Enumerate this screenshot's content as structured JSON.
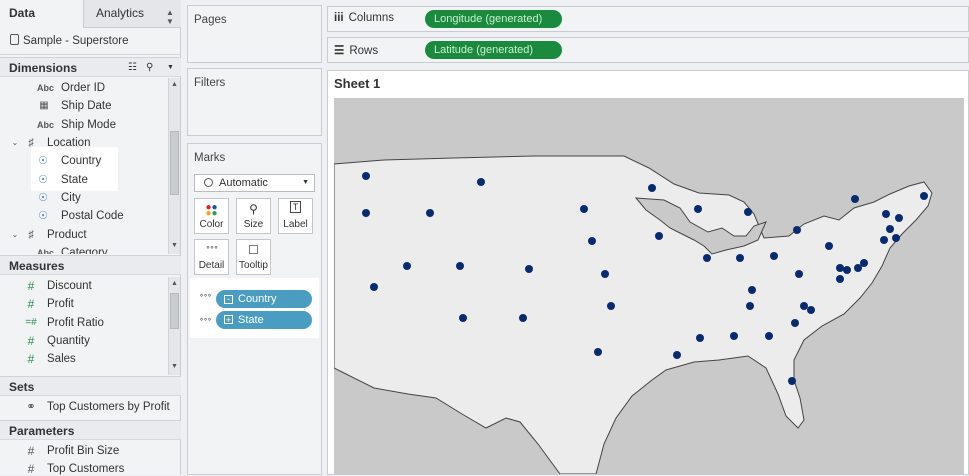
{
  "left_pane": {
    "tabs": {
      "data": "Data",
      "analytics": "Analytics"
    },
    "datasource": "Sample - Superstore",
    "dimensions": {
      "title": "Dimensions",
      "items": [
        {
          "icon": "Abc",
          "label": "Order ID"
        },
        {
          "icon": "calendar",
          "label": "Ship Date"
        },
        {
          "icon": "Abc",
          "label": "Ship Mode"
        },
        {
          "icon": "hierarchy",
          "label": "Location"
        },
        {
          "icon": "globe",
          "label": "Country"
        },
        {
          "icon": "globe",
          "label": "State"
        },
        {
          "icon": "globe",
          "label": "City"
        },
        {
          "icon": "globe",
          "label": "Postal Code"
        },
        {
          "icon": "hierarchy",
          "label": "Product"
        },
        {
          "icon": "Abc",
          "label": "Category"
        }
      ]
    },
    "measures": {
      "title": "Measures",
      "items": [
        {
          "icon": "#",
          "label": "Discount"
        },
        {
          "icon": "#",
          "label": "Profit"
        },
        {
          "icon": "=#",
          "label": "Profit Ratio"
        },
        {
          "icon": "#",
          "label": "Quantity"
        },
        {
          "icon": "#",
          "label": "Sales"
        }
      ]
    },
    "sets": {
      "title": "Sets",
      "items": [
        {
          "label": "Top Customers by Profit"
        }
      ]
    },
    "parameters": {
      "title": "Parameters",
      "items": [
        {
          "icon": "#",
          "label": "Profit Bin Size"
        },
        {
          "icon": "#",
          "label": "Top Customers"
        }
      ]
    }
  },
  "cards": {
    "pages": "Pages",
    "filters": "Filters",
    "marks": {
      "title": "Marks",
      "mark_type": "Automatic",
      "buttons": [
        "Color",
        "Size",
        "Label",
        "Detail",
        "Tooltip"
      ],
      "pills": [
        "Country",
        "State"
      ]
    }
  },
  "shelves": {
    "columns": {
      "label": "Columns",
      "pill": "Longitude (generated)"
    },
    "rows": {
      "label": "Rows",
      "pill": "Latitude (generated)"
    }
  },
  "sheet": {
    "title": "Sheet 1"
  },
  "colors": {
    "accent_blue": "#4a9cc0",
    "pill_green": "#1b8a3e",
    "map_dot": "#0a2a6e",
    "map_land": "#ededed"
  }
}
